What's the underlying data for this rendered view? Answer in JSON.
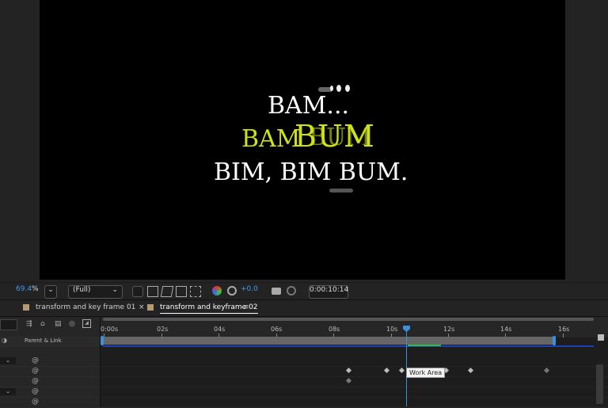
{
  "composition": {
    "line1": "BAM...",
    "line2_left": "BAM",
    "line2_big": "BUM",
    "line2_ghost": "BUM",
    "line3": "BIM, BIM BUM.",
    "accent_color": "#cfe312"
  },
  "viewer_toolbar": {
    "zoom_value": "69.4",
    "zoom_unit": "%",
    "resolution": "(Full)",
    "exposure": "+0.0",
    "current_time": "0:00:10:14"
  },
  "timeline": {
    "tabs": [
      {
        "label": "transform and key frame 01",
        "active": false
      },
      {
        "label": "transform and keyframe 02",
        "active": true
      }
    ],
    "close_glyph": "×",
    "menu_glyph": "≡",
    "ruler_ticks": [
      "0:00s",
      "02s",
      "04s",
      "06s",
      "08s",
      "10s",
      "12s",
      "14s",
      "16s"
    ],
    "column_header": "Parent & Link",
    "tooltip": "Work Area"
  }
}
